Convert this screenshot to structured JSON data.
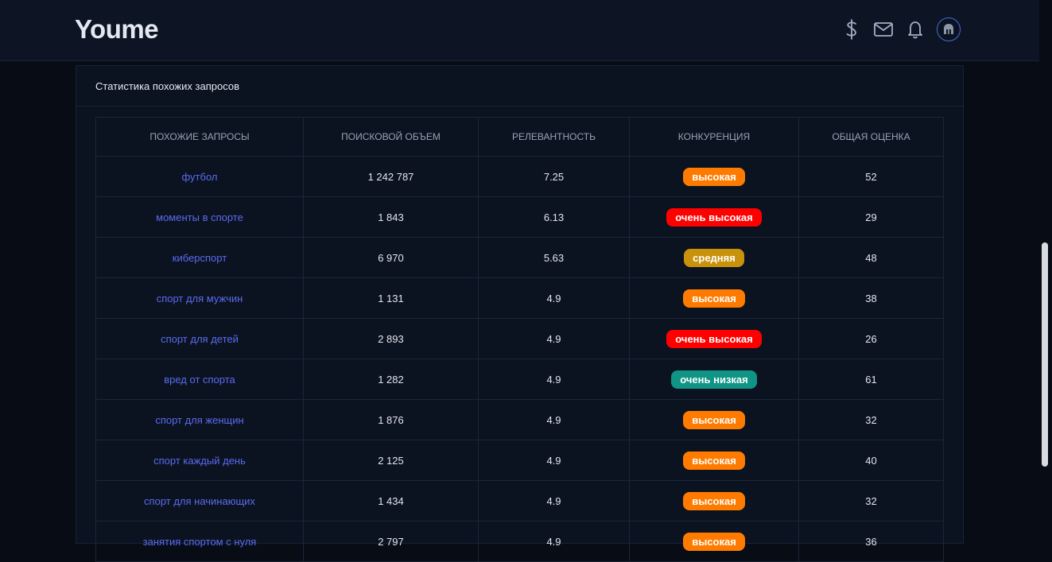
{
  "app": {
    "logo": "Youme"
  },
  "header_icons": [
    "dollar-icon",
    "mail-icon",
    "bell-icon",
    "user-avatar-helmet-icon"
  ],
  "card": {
    "title": "Статистика похожих запросов"
  },
  "table": {
    "columns": [
      "ПОХОЖИЕ ЗАПРОСЫ",
      "ПОИСКОВОЙ ОБЪЕМ",
      "РЕЛЕВАНТНОСТЬ",
      "КОНКУРЕНЦИЯ",
      "ОБЩАЯ ОЦЕНКА"
    ],
    "rows": [
      {
        "query": "футбол",
        "volume": "1 242 787",
        "relevance": "7.25",
        "competition": "высокая",
        "score": "52"
      },
      {
        "query": "моменты в спорте",
        "volume": "1 843",
        "relevance": "6.13",
        "competition": "очень высокая",
        "score": "29"
      },
      {
        "query": "киберспорт",
        "volume": "6 970",
        "relevance": "5.63",
        "competition": "средняя",
        "score": "48"
      },
      {
        "query": "спорт для мужчин",
        "volume": "1 131",
        "relevance": "4.9",
        "competition": "высокая",
        "score": "38"
      },
      {
        "query": "спорт для детей",
        "volume": "2 893",
        "relevance": "4.9",
        "competition": "очень высокая",
        "score": "26"
      },
      {
        "query": "вред от спорта",
        "volume": "1 282",
        "relevance": "4.9",
        "competition": "очень низкая",
        "score": "61"
      },
      {
        "query": "спорт для женщин",
        "volume": "1 876",
        "relevance": "4.9",
        "competition": "высокая",
        "score": "32"
      },
      {
        "query": "спорт каждый день",
        "volume": "2 125",
        "relevance": "4.9",
        "competition": "высокая",
        "score": "40"
      },
      {
        "query": "спорт для начинающих",
        "volume": "1 434",
        "relevance": "4.9",
        "competition": "высокая",
        "score": "32"
      },
      {
        "query": "занятия спортом с нуля",
        "volume": "2 797",
        "relevance": "4.9",
        "competition": "высокая",
        "score": "36"
      }
    ]
  },
  "badge_colors": {
    "высокая": "#ff7b00",
    "очень высокая": "#ff0000",
    "средняя": "#c8920a",
    "очень низкая": "#0f9486"
  },
  "colors": {
    "accent": "#5b6cf0",
    "background": "#070c15",
    "panel": "#0b1220"
  }
}
